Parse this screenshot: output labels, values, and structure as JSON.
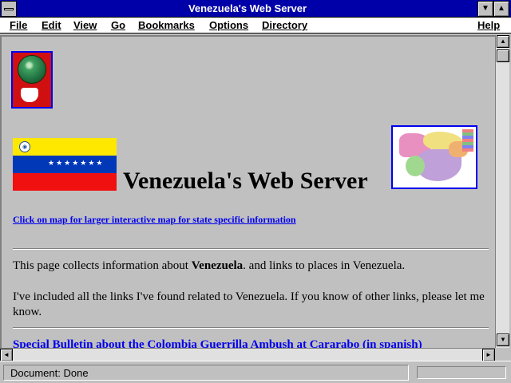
{
  "window": {
    "title": "Venezuela's Web Server",
    "minimize_glyph": "▼",
    "maximize_glyph": "▲"
  },
  "menu": {
    "items": [
      {
        "label": "File"
      },
      {
        "label": "Edit"
      },
      {
        "label": "View"
      },
      {
        "label": "Go"
      },
      {
        "label": "Bookmarks"
      },
      {
        "label": "Options"
      },
      {
        "label": "Directory"
      },
      {
        "label": "Help"
      }
    ]
  },
  "page": {
    "heading": "Venezuela's Web Server",
    "map_link": "Click on map for larger interactive map for state specific information",
    "intro_before": "This page collects information about ",
    "intro_bold": "Venezuela",
    "intro_after": ". and links to places in Venezuela.",
    "links_paragraph": "I've included all the links I've found related to Venezuela. If you know of other links, please let me know.",
    "bulletin_link": "Special Bulletin about the Colombia Guerrilla Ambush at Cararabo (in spanish)",
    "flag_colors": {
      "yellow": "#ffe800",
      "blue": "#0038b8",
      "red": "#f01010"
    },
    "flag_stars": "★★★★★★★"
  },
  "scrollbar": {
    "up_glyph": "▲",
    "down_glyph": "▼",
    "left_glyph": "◄",
    "right_glyph": "►"
  },
  "status": {
    "text": "Document: Done"
  },
  "colors": {
    "titlebar": "#0000a8",
    "link": "#0000ee",
    "chrome": "#c0c0c0"
  },
  "icons": {
    "system_menu": "system-menu-icon",
    "globe": "globe-logo-icon",
    "flag": "venezuela-flag-icon",
    "map": "venezuela-map-icon"
  }
}
